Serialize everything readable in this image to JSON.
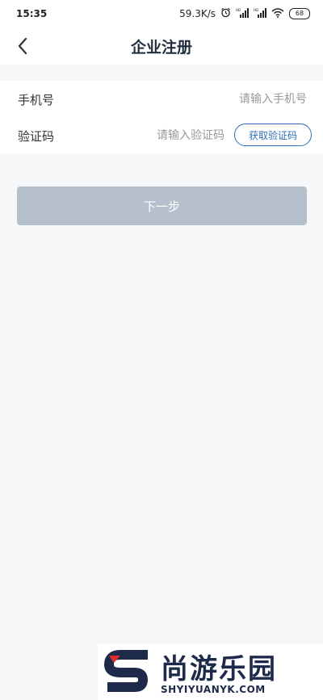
{
  "status_bar": {
    "time": "15:35",
    "network_speed": "59.3K/s",
    "battery": "68",
    "icons": [
      "alarm-icon",
      "signal-hd-icon",
      "signal-hd-icon",
      "wifi-icon",
      "battery-icon"
    ]
  },
  "nav": {
    "back_icon": "chevron-left-icon",
    "title": "企业注册"
  },
  "form": {
    "phone_label": "手机号",
    "phone_placeholder": "请输入手机号",
    "phone_value": "",
    "code_label": "验证码",
    "code_placeholder": "请输入验证码",
    "code_value": "",
    "get_code_label": "获取验证码"
  },
  "next_button": {
    "label": "下一步"
  },
  "watermark": {
    "title": "尚游乐园",
    "url": "SHYIYUANYK.COM"
  },
  "colors": {
    "accent": "#2f6fb5",
    "title": "#1f2d3d",
    "disabled_button": "#b6c0cc",
    "background": "#f6f7f9"
  }
}
